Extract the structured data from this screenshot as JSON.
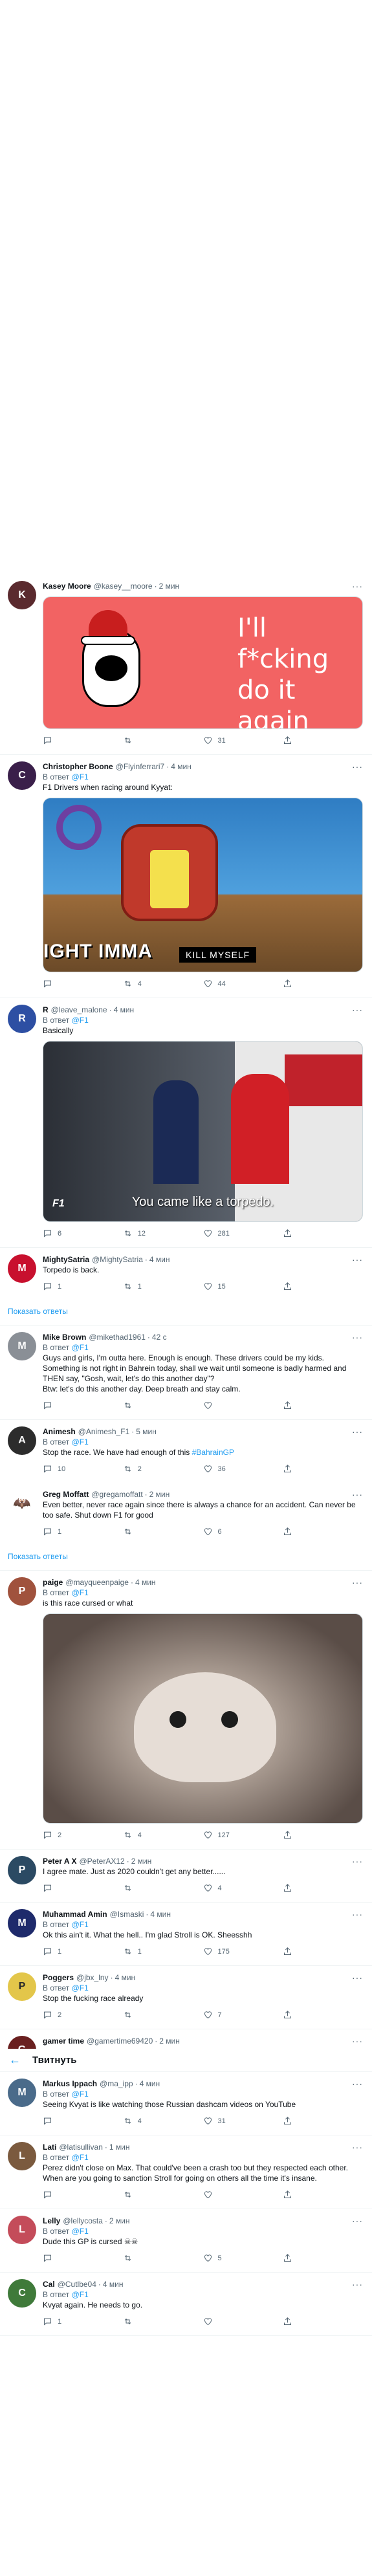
{
  "header": {
    "title": "Твитнуть"
  },
  "show_replies_label": "Показать ответы",
  "reply_prefix": "В ответ",
  "tweets": [
    {
      "name": "Kasey Moore",
      "handle": "@kasey__moore",
      "time": "2 мин",
      "reply_to": "",
      "text": "",
      "media_text": "I'll\nf*cking\ndo it\nagain",
      "counts": {
        "reply": "",
        "retweet": "",
        "like": "31"
      }
    },
    {
      "name": "Christopher Boone",
      "handle": "@Flyinferrari7",
      "time": "4 мин",
      "reply_to": "@F1",
      "text": "F1 Drivers when racing around Kyyat:",
      "media_text": "IGHT IMMA",
      "media_text2": "KILL MYSELF",
      "counts": {
        "reply": "",
        "retweet": "4",
        "like": "44"
      }
    },
    {
      "name": "R",
      "handle": "@leave_malone",
      "time": "4 мин",
      "reply_to": "@F1",
      "text": "Basically",
      "media_text": "You came like a torpedo.",
      "counts": {
        "reply": "6",
        "retweet": "12",
        "like": "281"
      }
    },
    {
      "name": "MightySatria",
      "handle": "@MightySatria",
      "time": "4 мин",
      "reply_to": "",
      "text": "Torpedo is back.",
      "counts": {
        "reply": "1",
        "retweet": "1",
        "like": "15"
      }
    },
    {
      "name": "Mike Brown",
      "handle": "@mikethad1961",
      "time": "42 с",
      "reply_to": "@F1",
      "text": "Guys and girls, I'm outta here. Enough is enough. These drivers could be my kids. Something is not right in Bahrein today, shall we wait until someone is badly harmed and THEN say, \"Gosh, wait, let's do this another day\"?\nBtw: let's do this another day. Deep breath and stay calm.",
      "counts": {
        "reply": "",
        "retweet": "",
        "like": ""
      }
    },
    {
      "name": "Animesh",
      "handle": "@Animesh_F1",
      "time": "5 мин",
      "reply_to": "@F1",
      "text": "Stop the race. We have had enough of this ",
      "hashtag": "#BahrainGP",
      "counts": {
        "reply": "10",
        "retweet": "2",
        "like": "36"
      }
    },
    {
      "name": "Greg Moffatt",
      "handle": "@gregamoffatt",
      "time": "2 мин",
      "reply_to": "",
      "text": "Even better, never race again since there is always a chance for an accident. Can never be too safe. Shut down F1 for good",
      "counts": {
        "reply": "1",
        "retweet": "",
        "like": "6"
      }
    },
    {
      "name": "paige",
      "handle": "@mayqueenpaige",
      "time": "4 мин",
      "reply_to": "@F1",
      "text": "is this race cursed or what",
      "counts": {
        "reply": "2",
        "retweet": "4",
        "like": "127"
      }
    },
    {
      "name": "Peter A X",
      "handle": "@PeterAX12",
      "time": "2 мин",
      "reply_to": "",
      "text": "I agree mate. Just as 2020 couldn't get any better......",
      "counts": {
        "reply": "",
        "retweet": "",
        "like": "4"
      }
    },
    {
      "name": "Muhammad Amin",
      "handle": "@Ismaski",
      "time": "4 мин",
      "reply_to": "@F1",
      "text": "Ok this ain't it. What the hell.. I'm glad Stroll is OK. Sheesshh",
      "counts": {
        "reply": "1",
        "retweet": "1",
        "like": "175"
      }
    },
    {
      "name": "Poggers",
      "handle": "@jbx_lny",
      "time": "4 мин",
      "reply_to": "@F1",
      "text": "Stop the fucking race already",
      "counts": {
        "reply": "2",
        "retweet": "",
        "like": "7"
      }
    },
    {
      "name": "gamer time",
      "handle": "@gamertime69420",
      "time": "2 мин",
      "reply_to": "",
      "text": "",
      "counts": {
        "reply": "",
        "retweet": "",
        "like": ""
      }
    },
    {
      "name": "Markus Ippach",
      "handle": "@ma_ipp",
      "time": "4 мин",
      "reply_to": "@F1",
      "text": "Seeing Kvyat is like watching those Russian dashcam videos on YouTube",
      "counts": {
        "reply": "",
        "retweet": "4",
        "like": "31"
      }
    },
    {
      "name": "Lati",
      "handle": "@latisullivan",
      "time": "1 мин",
      "reply_to": "@F1",
      "text": "Perez didn't close on Max. That could've been a crash too but they respected each other. When are you going to sanction Stroll for going on others all the time it's insane.",
      "counts": {
        "reply": "",
        "retweet": "",
        "like": ""
      }
    },
    {
      "name": "Lelly",
      "handle": "@lellycosta",
      "time": "2 мин",
      "reply_to": "@F1",
      "text": "Dude this GP is cursed ☠☠",
      "counts": {
        "reply": "",
        "retweet": "",
        "like": "5"
      }
    },
    {
      "name": "Cal",
      "handle": "@Cutlbe04",
      "time": "4 мин",
      "reply_to": "@F1",
      "text": "Kvyat again. He needs to go.",
      "counts": {
        "reply": "1",
        "retweet": "",
        "like": ""
      }
    }
  ]
}
